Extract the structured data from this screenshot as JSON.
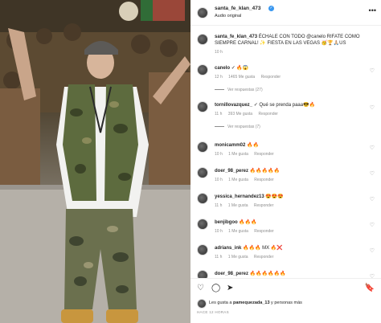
{
  "header": {
    "username": "santa_fe_klan_473",
    "verified_mark": "✓",
    "audio": "Audio original",
    "more": "•••"
  },
  "caption": {
    "username": "santa_fe_klan_473",
    "text": "ÉCHALE CON TODO @canelo RIFATE COMO SIEMPRE CARNAL! ✨ FIESTA EN LAS VEGAS 🥳🏆🙏🏼US",
    "time": "10 h"
  },
  "comments": [
    {
      "user": "canelo",
      "text": "✓ 🔥😱",
      "time": "12 h",
      "likes": "1465 Me gusta",
      "reply": "Responder",
      "view_replies": "Ver respuestas (27)"
    },
    {
      "user": "tornillovazquez_",
      "text": "✓ Qué se prenda paaa😎🔥",
      "time": "11 h",
      "likes": "393 Me gusta",
      "reply": "Responder",
      "view_replies": "Ver respuestas (7)"
    },
    {
      "user": "monicamm02",
      "text": "🔥🔥",
      "time": "10 h",
      "likes": "1 Me gusta",
      "reply": "Responder"
    },
    {
      "user": "doer_98_perez",
      "text": "🔥🔥🔥🔥🔥",
      "time": "10 h",
      "likes": "1 Me gusta",
      "reply": "Responder"
    },
    {
      "user": "yessica_hernandez13",
      "text": "😍😍😍",
      "time": "11 h",
      "likes": "1 Me gusta",
      "reply": "Responder"
    },
    {
      "user": "benjibgoo",
      "text": "🔥🔥🔥",
      "time": "10 h",
      "likes": "1 Me gusta",
      "reply": "Responder"
    },
    {
      "user": "adrians_ink",
      "text": "🔥🔥🔥 MX 🔥❌",
      "time": "11 h",
      "likes": "1 Me gusta",
      "reply": "Responder"
    },
    {
      "user": "doer_98_perez",
      "text": "🔥🔥🔥🔥🔥🔥",
      "time": "",
      "likes": "",
      "reply": ""
    }
  ],
  "actions": {
    "like": "♡",
    "comment": "◯",
    "share": "➤",
    "save": "🔖"
  },
  "likes": {
    "prefix": "Les gusta a ",
    "user": "pamequezada_13",
    "suffix": " y personas más"
  },
  "posted_ago": "HACE 12 HORAS"
}
